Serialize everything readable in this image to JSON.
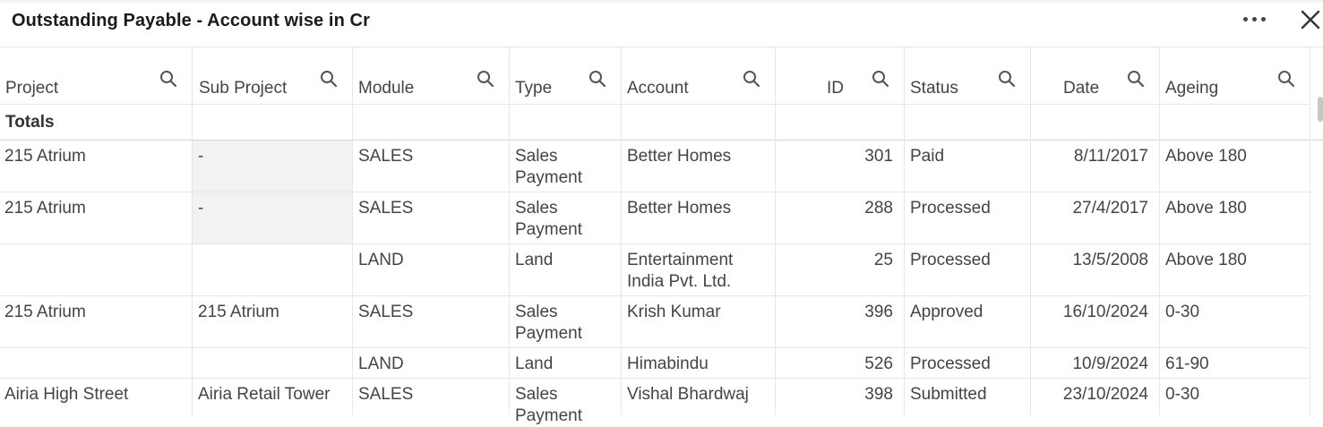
{
  "window": {
    "title": "Outstanding Payable - Account wise in Cr"
  },
  "icons": {
    "more": "more-horizontal-icon",
    "close": "close-icon",
    "search": "search-icon"
  },
  "columns": [
    {
      "key": "project",
      "label": "Project"
    },
    {
      "key": "sub_project",
      "label": "Sub Project"
    },
    {
      "key": "module",
      "label": "Module"
    },
    {
      "key": "type",
      "label": "Type"
    },
    {
      "key": "account",
      "label": "Account"
    },
    {
      "key": "id",
      "label": "ID"
    },
    {
      "key": "status",
      "label": "Status"
    },
    {
      "key": "date",
      "label": "Date"
    },
    {
      "key": "ageing",
      "label": "Ageing"
    }
  ],
  "totals_label": "Totals",
  "rows": [
    {
      "project": "215 Atrium",
      "sub_project": "-",
      "module": "SALES",
      "type": "Sales\nPayment",
      "account": "Better Homes",
      "id": "301",
      "status": "Paid",
      "date": "8/11/2017",
      "ageing": "Above 180"
    },
    {
      "project": "215 Atrium",
      "sub_project": "-",
      "module": "SALES",
      "type": "Sales\nPayment",
      "account": "Better Homes",
      "id": "288",
      "status": "Processed",
      "date": "27/4/2017",
      "ageing": "Above 180"
    },
    {
      "project": "",
      "sub_project": "",
      "module": "LAND",
      "type": "Land",
      "account": "Entertainment\nIndia Pvt. Ltd.",
      "id": "25",
      "status": "Processed",
      "date": "13/5/2008",
      "ageing": "Above 180"
    },
    {
      "project": "215 Atrium",
      "sub_project": "215 Atrium",
      "module": "SALES",
      "type": "Sales\nPayment",
      "account": "Krish Kumar",
      "id": "396",
      "status": "Approved",
      "date": "16/10/2024",
      "ageing": "0-30"
    },
    {
      "project": "",
      "sub_project": "",
      "module": "LAND",
      "type": "Land",
      "account": "Himabindu",
      "id": "526",
      "status": "Processed",
      "date": "10/9/2024",
      "ageing": "61-90"
    },
    {
      "project": "Airia High Street",
      "sub_project": "Airia Retail Tower",
      "module": "SALES",
      "type": "Sales\nPayment",
      "account": "Vishal Bhardwaj",
      "id": "398",
      "status": "Submitted",
      "date": "23/10/2024",
      "ageing": "0-30"
    }
  ]
}
